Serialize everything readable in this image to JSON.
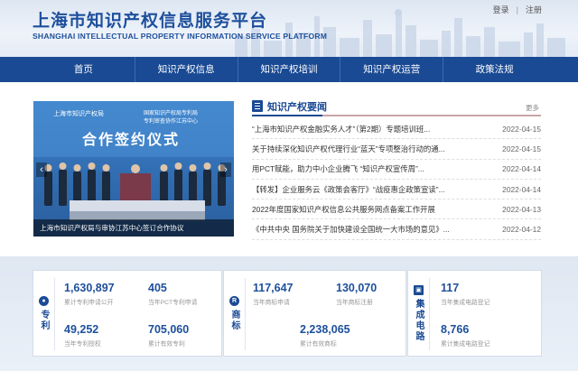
{
  "header": {
    "title_cn": "上海市知识产权信息服务平台",
    "title_en": "SHANGHAI INTELLECTUAL PROPERTY INFORMATION SERVICE PLATFORM",
    "login": "登录",
    "register": "注册"
  },
  "nav": [
    "首页",
    "知识产权信息",
    "知识产权培训",
    "知识产权运营",
    "政策法规"
  ],
  "carousel": {
    "caption": "上海市知识产权局与审协江苏中心签订合作协议",
    "slide_heading": "合作签约仪式",
    "slide_org_left": "上海市知识产权局",
    "slide_org_right_1": "国家知识产权局专利局",
    "slide_org_right_2": "专利审查协作江苏中心",
    "prev_glyph": "‹",
    "next_glyph": "›"
  },
  "news": {
    "title": "知识产权要闻",
    "more": "更多",
    "items": [
      {
        "title": "“上海市知识产权金融实务人才”（第2期）专题培训班...",
        "date": "2022-04-15"
      },
      {
        "title": "关于持续深化知识产权代理行业“蓝天”专项整治行动的通...",
        "date": "2022-04-15"
      },
      {
        "title": "用PCT赋能，助力中小企业腾飞 “知识产权宣传周”...",
        "date": "2022-04-14"
      },
      {
        "title": "【转发】企业服务云《政策会客厅》“战疫惠企政策宣读”...",
        "date": "2022-04-14"
      },
      {
        "title": "2022年度国家知识产权信息公共服务网点备案工作开展",
        "date": "2022-04-13"
      },
      {
        "title": "《中共中央 国务院关于加快建设全国统一大市场的意见》...",
        "date": "2022-04-12"
      }
    ]
  },
  "stats": {
    "patent": {
      "label": "专利",
      "icon": "person-icon",
      "items": [
        {
          "value": "1,630,897",
          "label": "累计专利申请公开"
        },
        {
          "value": "405",
          "label": "当年PCT专利申请"
        },
        {
          "value": "49,252",
          "label": "当年专利授权"
        },
        {
          "value": "705,060",
          "label": "累计有效专利"
        }
      ]
    },
    "trademark": {
      "label": "商标",
      "icon_text": "R",
      "items": [
        {
          "value": "117,647",
          "label": "当年商标申请"
        },
        {
          "value": "130,070",
          "label": "当年商标注册"
        },
        {
          "value": "2,238,065",
          "label": "累计有效商标"
        }
      ]
    },
    "ic": {
      "label": "集成电路",
      "icon": "chip-icon",
      "items": [
        {
          "value": "117",
          "label": "当年集成电路登记"
        },
        {
          "value": "8,766",
          "label": "累计集成电路登记"
        }
      ]
    }
  },
  "colors": {
    "brand": "#1a4a94",
    "title": "#1d4f9c"
  }
}
